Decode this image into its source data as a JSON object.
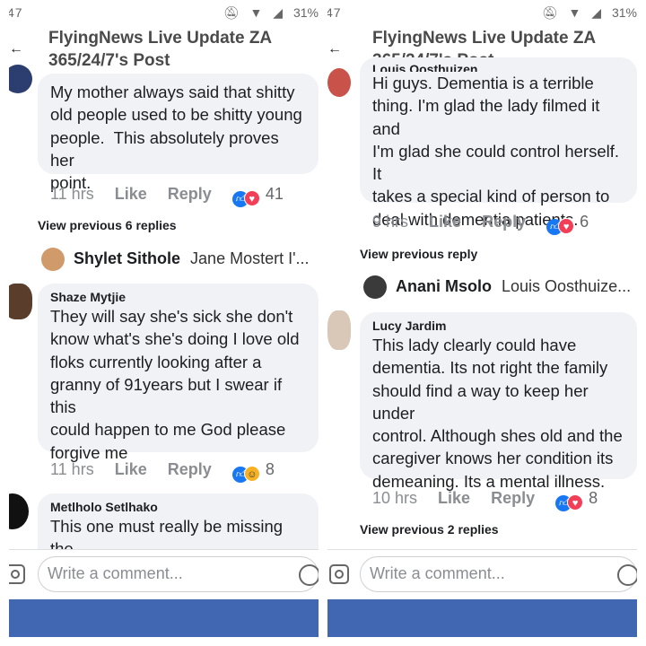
{
  "left": {
    "status": {
      "time": "47",
      "carrier": "N",
      "battery": "31%"
    },
    "header": {
      "back": "←",
      "title_line1": "FlyingNews Live Update ZA",
      "title_line2": "365/24/7's Post"
    },
    "comment1": {
      "text": "My mother always said that shitty\nold people used to be shitty young\npeople.  This absolutely proves her\npoint.",
      "time": "11 hrs",
      "like": "Like",
      "reply": "Reply",
      "count": "41"
    },
    "view_previous": "View previous 6 replies",
    "reply_row": {
      "name": "Shylet Sithole",
      "preview": "Jane Mostert  I'..."
    },
    "comment2": {
      "author": "Shaze Mytjie",
      "text": "They will say she's sick she don't\nknow what's she's doing I love old\nfloks currently looking after a\ngranny of 91years but I swear if this\ncould happen to me God please\nforgive me",
      "time": "11 hrs",
      "like": "Like",
      "reply": "Reply",
      "count": "8"
    },
    "comment3": {
      "author": "Metlholo Setlhako",
      "text": "This one must really be missing the\nold SA this is how she definitely"
    },
    "composer": {
      "placeholder": "Write a comment..."
    }
  },
  "right": {
    "status": {
      "time": "47",
      "carrier": "N",
      "battery": "31%"
    },
    "header": {
      "back": "←",
      "title_line1": "FlyingNews Live Update ZA",
      "title_line2": "365/24/7's Post"
    },
    "comment1": {
      "author": "Louis Oosthuizen",
      "text": "Hi guys. Dementia is a terrible\nthing. I'm glad the lady filmed it and\nI'm glad she could control herself. It\ntakes a special kind of person to\ndeal with dementia patients.",
      "time": "9 hrs",
      "like": "Like",
      "reply": "Reply",
      "count": "6"
    },
    "view_previous": "View previous reply",
    "reply_row": {
      "name": "Anani Msolo",
      "preview": "Louis Oosthuize..."
    },
    "comment2": {
      "author": "Lucy Jardim",
      "text": "This lady clearly could have\ndementia. Its not right the family\nshould find a way to keep her under\ncontrol. Although shes old and the\ncaregiver knows her condition its\ndemeaning. Its a mental illness.",
      "time": "10 hrs",
      "like": "Like",
      "reply": "Reply",
      "count": "8"
    },
    "view_previous2": "View previous 2 replies",
    "composer": {
      "placeholder": "Write a comment..."
    }
  },
  "colors": {
    "bubble": "#f0f2f5",
    "like_blue": "#1877f2",
    "love_red": "#f33e58",
    "haha_yellow": "#f7b125",
    "bottom_bar": "#4267b2"
  }
}
